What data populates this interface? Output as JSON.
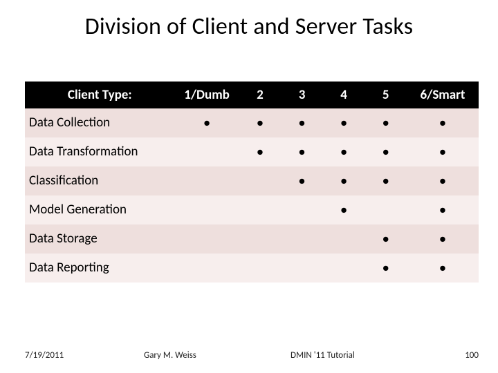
{
  "title": "Division of Client and Server Tasks",
  "columns": [
    "Client Type:",
    "1/Dumb",
    "2",
    "3",
    "4",
    "5",
    "6/Smart"
  ],
  "rows": [
    {
      "label": "Data Collection",
      "marks": [
        true,
        true,
        true,
        true,
        true,
        true
      ]
    },
    {
      "label": "Data Transformation",
      "marks": [
        false,
        true,
        true,
        true,
        true,
        true
      ]
    },
    {
      "label": "Classification",
      "marks": [
        false,
        false,
        true,
        true,
        true,
        true
      ]
    },
    {
      "label": "Model Generation",
      "marks": [
        false,
        false,
        false,
        true,
        false,
        true
      ]
    },
    {
      "label": "Data Storage",
      "marks": [
        false,
        false,
        false,
        false,
        true,
        true
      ]
    },
    {
      "label": "Data Reporting",
      "marks": [
        false,
        false,
        false,
        false,
        true,
        true
      ]
    }
  ],
  "footer": {
    "date": "7/19/2011",
    "author": "Gary M. Weiss",
    "venue": "DMIN '11 Tutorial",
    "page": "100"
  },
  "dot": "●",
  "chart_data": {
    "type": "table",
    "title": "Division of Client and Server Tasks",
    "columns": [
      "1/Dumb",
      "2",
      "3",
      "4",
      "5",
      "6/Smart"
    ],
    "rows": [
      "Data Collection",
      "Data Transformation",
      "Classification",
      "Model Generation",
      "Data Storage",
      "Data Reporting"
    ],
    "matrix": [
      [
        1,
        1,
        1,
        1,
        1,
        1
      ],
      [
        0,
        1,
        1,
        1,
        1,
        1
      ],
      [
        0,
        0,
        1,
        1,
        1,
        1
      ],
      [
        0,
        0,
        0,
        1,
        0,
        1
      ],
      [
        0,
        0,
        0,
        0,
        1,
        1
      ],
      [
        0,
        0,
        0,
        0,
        1,
        1
      ]
    ]
  }
}
